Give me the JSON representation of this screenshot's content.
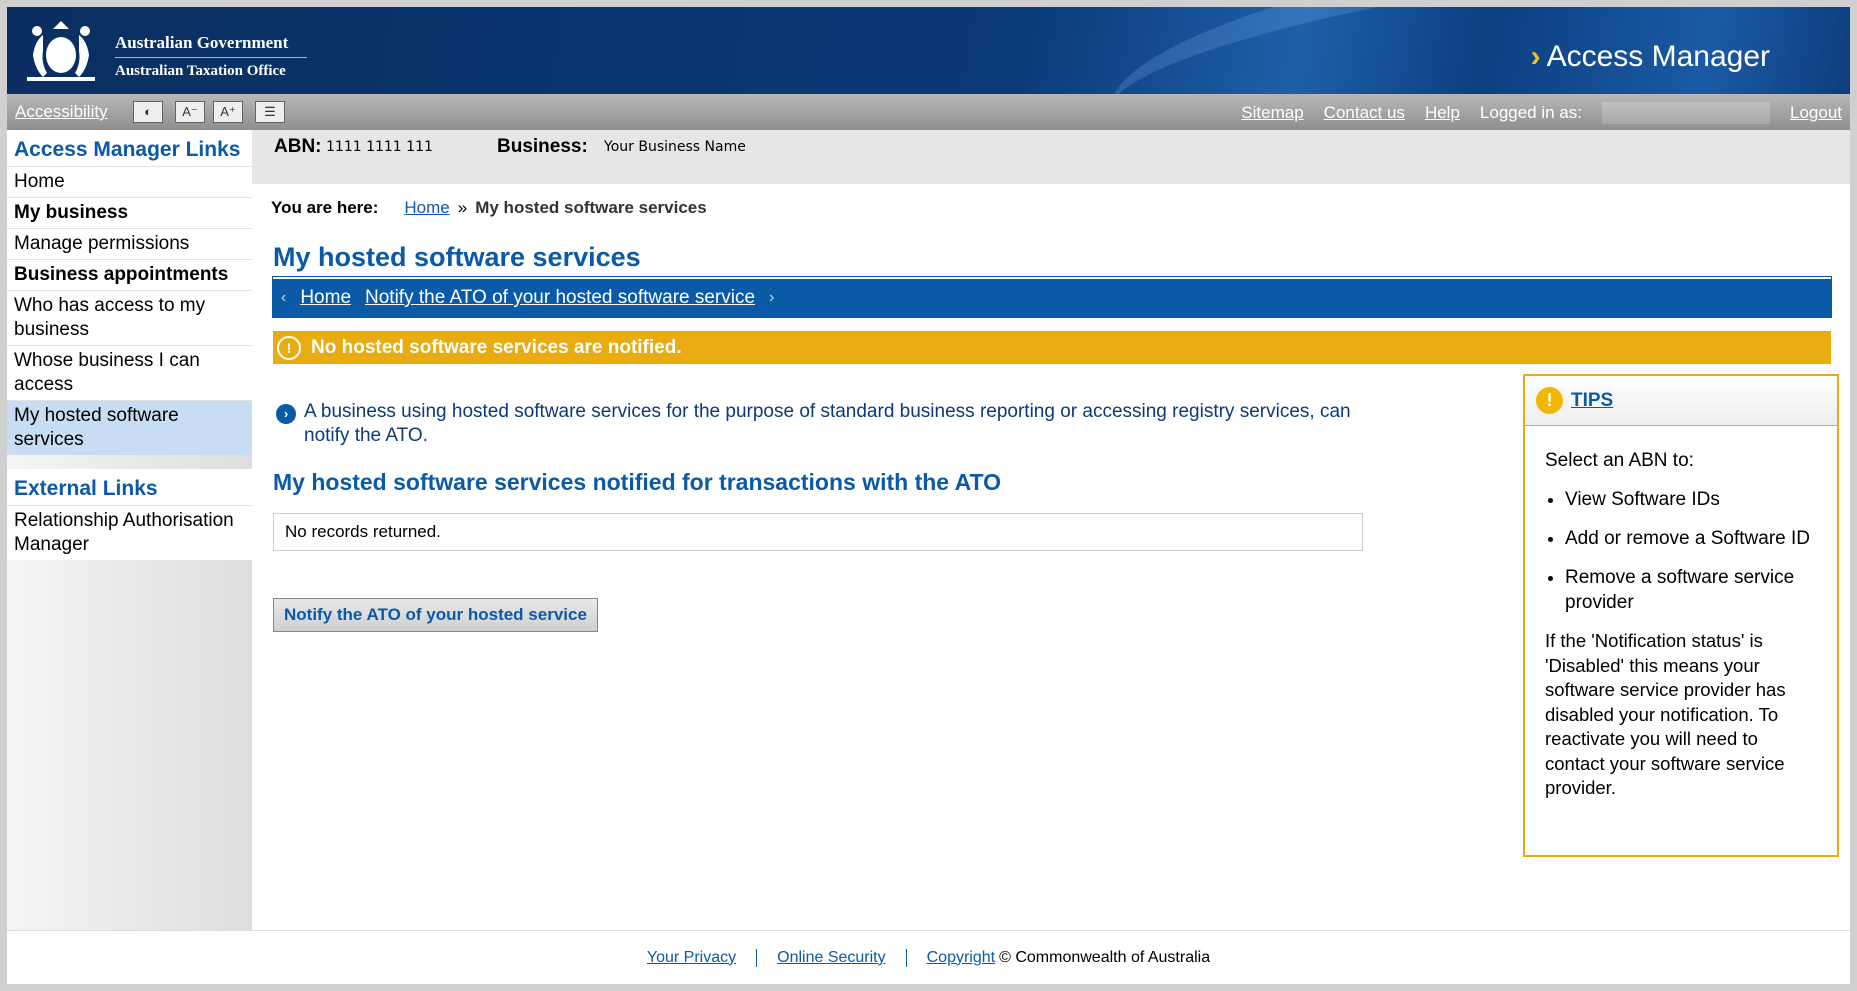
{
  "header": {
    "gov_line1": "Australian Government",
    "gov_line2": "Australian Taxation Office",
    "app_title": "Access Manager"
  },
  "toolbar": {
    "accessibility": "Accessibility",
    "contrast_icon": "contrast-icon",
    "text_smaller": "A⁻",
    "text_larger": "A⁺",
    "print_icon": "layout-icon",
    "links": [
      "Sitemap",
      "Contact us",
      "Help"
    ],
    "logged_in_label": "Logged in as:",
    "logout": "Logout"
  },
  "sidebar": {
    "heading": "Access Manager Links",
    "items": [
      {
        "label": "Home"
      },
      {
        "label": "My business"
      },
      {
        "label": "Manage permissions"
      },
      {
        "label": "Business appointments"
      },
      {
        "label": "Who has access to my business"
      },
      {
        "label": "Whose business I can access"
      },
      {
        "label": "My hosted software services"
      }
    ],
    "external_heading": "External Links",
    "external_items": [
      {
        "label": "Relationship Authorisation Manager"
      }
    ]
  },
  "abn_bar": {
    "abn_label": "ABN:",
    "abn_value": "1111 1111 111",
    "business_label": "Business:",
    "business_value": "Your Business Name"
  },
  "breadcrumb": {
    "prefix": "You are here:",
    "home": "Home",
    "separator": "»",
    "current": "My hosted software services"
  },
  "page_title": "My hosted software services",
  "subnav": {
    "home": "Home",
    "notify": "Notify the ATO of your hosted software service"
  },
  "warning": "No hosted software services are notified.",
  "info_text": "A business using hosted software services for the purpose of standard business reporting or accessing registry services, can notify the ATO.",
  "section_heading": "My hosted software services notified for transactions with the ATO",
  "records_text": "No records returned.",
  "notify_button": "Notify the ATO of your hosted service",
  "tips": {
    "title": "TIPS",
    "intro": "Select an ABN to:",
    "items": [
      "View Software IDs",
      "Add or remove a Software ID",
      "Remove a software service provider"
    ],
    "note": "If the 'Notification status' is 'Disabled' this means your software service provider has disabled your notification. To reactivate you will need to contact your software service provider."
  },
  "footer": {
    "privacy": "Your Privacy",
    "security": "Online Security",
    "copyright_link": "Copyright",
    "copyright_text": "© Commonwealth of Australia"
  },
  "colors": {
    "brand_blue": "#0b5aa8",
    "warning_amber": "#e8ac10",
    "header_navy": "#0b3a78"
  }
}
